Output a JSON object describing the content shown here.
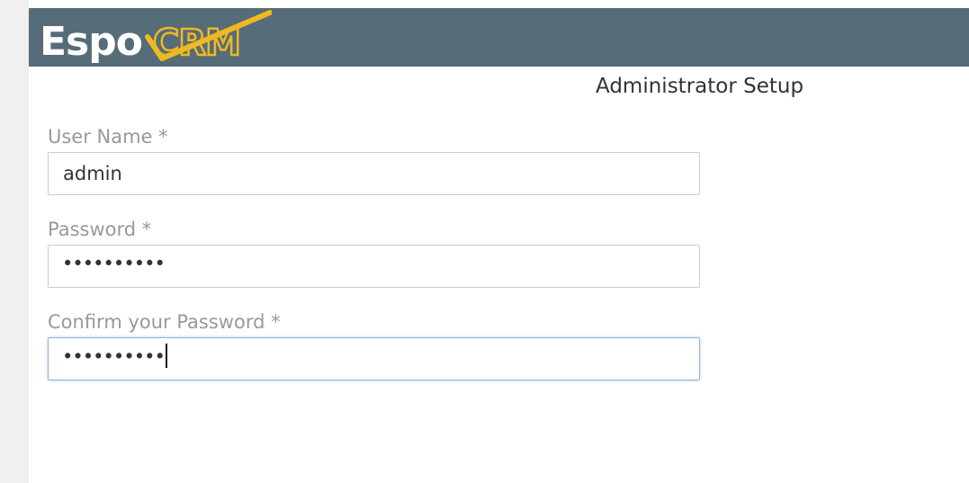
{
  "header": {
    "logo_text": "EspoCRM",
    "background_color": "#566c78",
    "accent_color": "#f0b821"
  },
  "page_title": "Administrator Setup",
  "form": {
    "username": {
      "label": "User Name *",
      "value": "admin"
    },
    "password": {
      "label": "Password *",
      "masked_value": "••••••••••"
    },
    "confirm_password": {
      "label": "Confirm your Password *",
      "masked_value": "••••••••••",
      "focused": true
    }
  }
}
